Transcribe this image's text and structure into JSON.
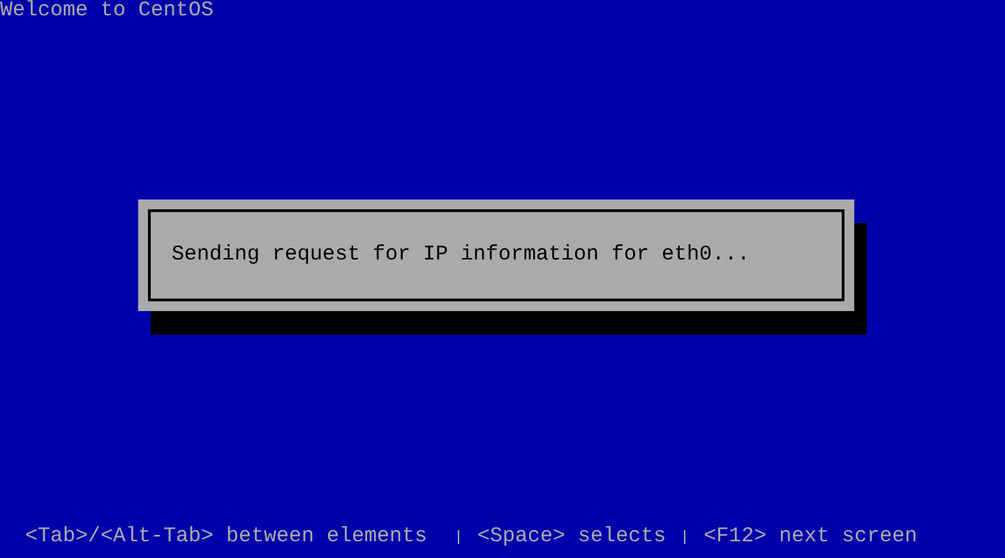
{
  "screen_title": "Welcome to CentOS",
  "dialog": {
    "message": "Sending request for IP information for eth0..."
  },
  "help_line": [
    "<Tab>/<Alt-Tab> between elements",
    "<Space> selects",
    "<F12> next screen"
  ]
}
